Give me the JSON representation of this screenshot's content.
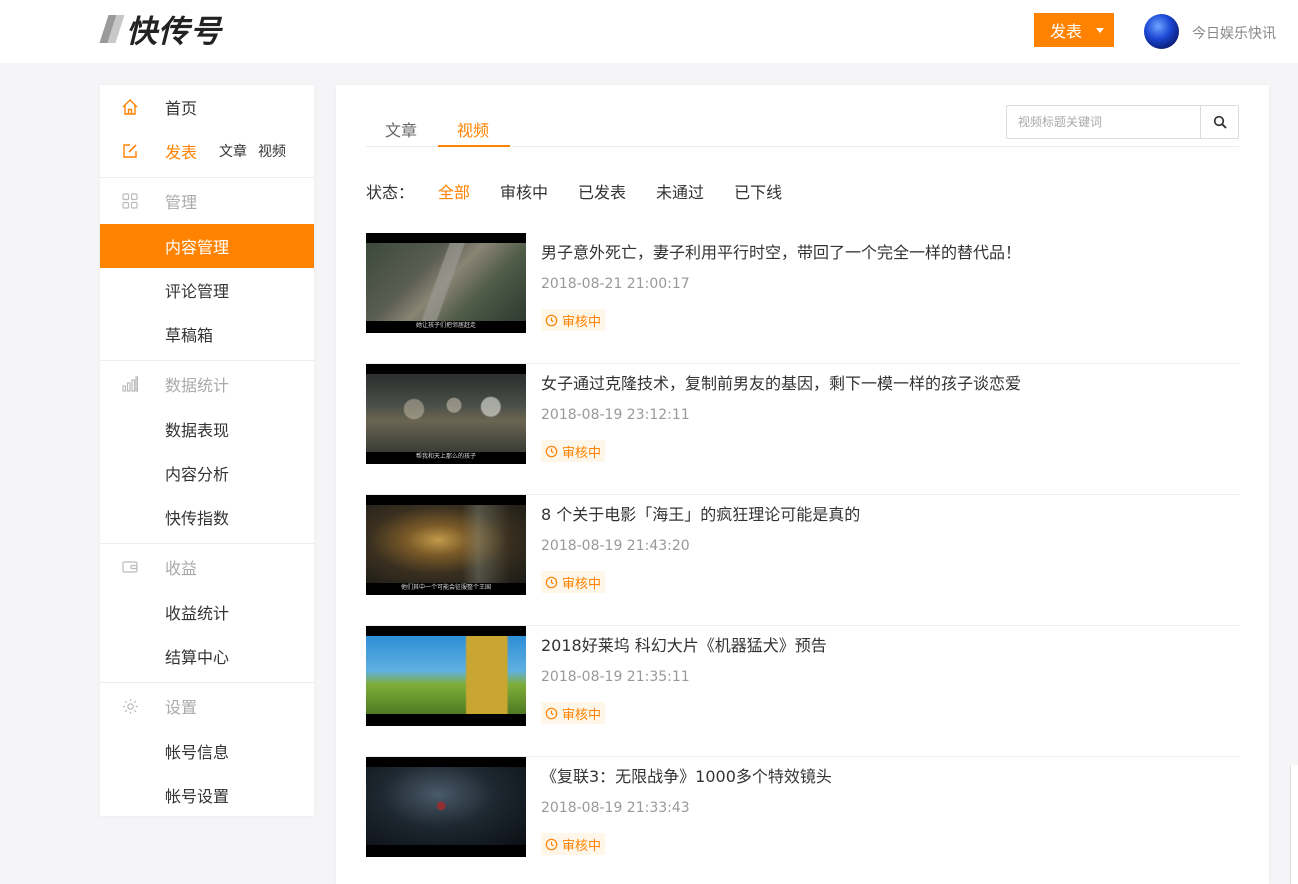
{
  "header": {
    "logo_text": "快传号",
    "publish_label": "发表",
    "username": "今日娱乐快讯"
  },
  "sidebar": {
    "home": "首页",
    "publish": "发表",
    "publish_article": "文章",
    "publish_video": "视频",
    "manage": "管理",
    "content_manage": "内容管理",
    "comment_manage": "评论管理",
    "drafts": "草稿箱",
    "stats": "数据统计",
    "data_performance": "数据表现",
    "content_analysis": "内容分析",
    "kuaichuan_index": "快传指数",
    "income": "收益",
    "income_stats": "收益统计",
    "settlement": "结算中心",
    "settings": "设置",
    "account_info": "帐号信息",
    "account_settings": "帐号设置"
  },
  "tabs": {
    "article": "文章",
    "video": "视频"
  },
  "search": {
    "placeholder": "视频标题关键词"
  },
  "status": {
    "label": "状态：",
    "options": [
      "全部",
      "审核中",
      "已发表",
      "未通过",
      "已下线"
    ]
  },
  "items": [
    {
      "title": "男子意外死亡，妻子利用平行时空，带回了一个完全一样的替代品！",
      "date": "2018-08-21 21:00:17",
      "status": "审核中",
      "subtitle": "她让孩子们把邻居赶走"
    },
    {
      "title": "女子通过克隆技术，复制前男友的基因，剩下一模一样的孩子谈恋爱",
      "date": "2018-08-19 23:12:11",
      "status": "审核中",
      "subtitle": "帮我和天上那么的孩子"
    },
    {
      "title": "8 个关于电影「海王」的疯狂理论可能是真的",
      "date": "2018-08-19 21:43:20",
      "status": "审核中",
      "subtitle": "他们其中一个可能会征服整个王国"
    },
    {
      "title": "2018好莱坞 科幻大片《机器猛犬》预告",
      "date": "2018-08-19 21:35:11",
      "status": "审核中",
      "subtitle": ""
    },
    {
      "title": "《复联3：无限战争》1000多个特效镜头",
      "date": "2018-08-19 21:33:43",
      "status": "审核中",
      "subtitle": ""
    }
  ],
  "colors": {
    "accent": "#ff8200",
    "pending_bg": "#fff6ea"
  }
}
